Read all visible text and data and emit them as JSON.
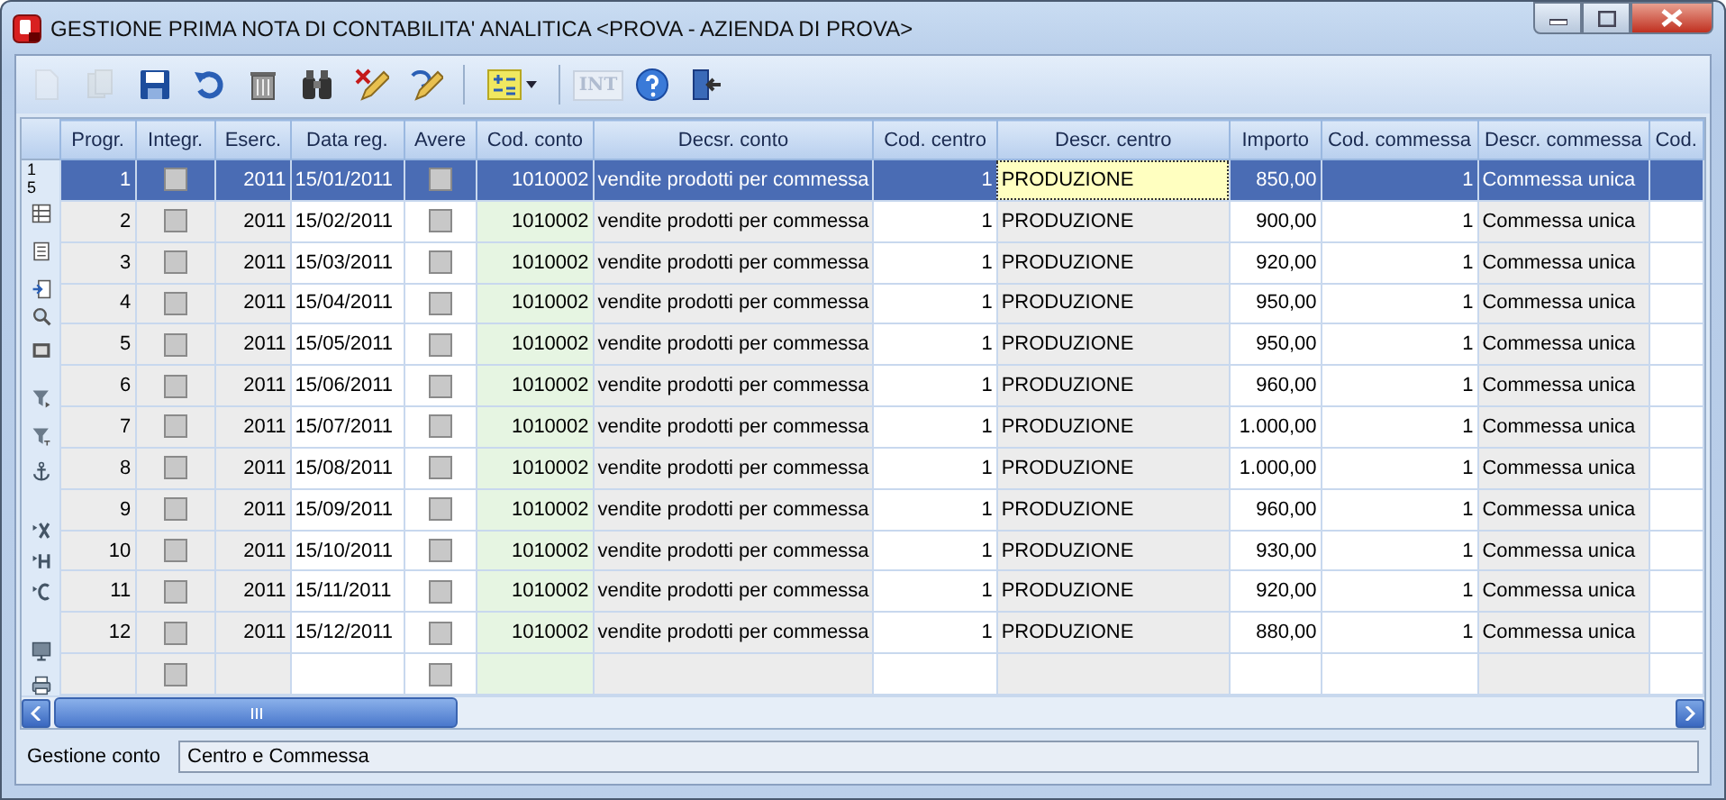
{
  "window": {
    "title": "GESTIONE PRIMA NOTA DI CONTABILITA' ANALITICA <PROVA - AZIENDA DI PROVA>"
  },
  "toolbar": [
    {
      "disabled": true
    },
    {
      "disabled": true
    },
    {
      "disabled": false
    },
    {
      "disabled": false
    },
    {
      "disabled": false
    },
    {
      "disabled": false
    },
    {
      "disabled": false
    },
    {
      "disabled": false
    },
    {
      "disabled": false
    },
    {
      "label": "INT",
      "disabled": true
    },
    {
      "disabled": false
    },
    {
      "disabled": false
    }
  ],
  "record_counter": [
    "1",
    "5"
  ],
  "table": {
    "columns": [
      {
        "label": "Progr.",
        "kind": "readonly-number"
      },
      {
        "label": "Integr.",
        "kind": "readonly-text"
      },
      {
        "label": "Eserc.",
        "kind": "readonly-number"
      },
      {
        "label": "Data reg.",
        "kind": "editable-text"
      },
      {
        "label": "Avere",
        "kind": "editable-text"
      },
      {
        "label": "Cod. conto",
        "kind": "lookup-number"
      },
      {
        "label": "Decsr. conto",
        "kind": "readonly-text"
      },
      {
        "label": "Cod. centro",
        "kind": "editable-number"
      },
      {
        "label": "Descr. centro",
        "kind": "readonly-text"
      },
      {
        "label": "Importo",
        "kind": "editable-number"
      },
      {
        "label": "Cod. commessa",
        "kind": "editable-number"
      },
      {
        "label": "Descr. commessa",
        "kind": "readonly-text"
      },
      {
        "label": "Cod.",
        "kind": "editable-text"
      }
    ],
    "rows": [
      {
        "selected": true,
        "cells": [
          "1",
          {
            "checked": false
          },
          "2011",
          "15/01/2011",
          {
            "checked": false
          },
          "1010002",
          "vendite prodotti per commessa",
          "1",
          {
            "text": "PRODUZIONE",
            "focused": true
          },
          "850,00",
          "1",
          "Commessa unica"
        ]
      },
      {
        "selected": false,
        "cells": [
          "2",
          {
            "checked": false
          },
          "2011",
          "15/02/2011",
          {
            "checked": false
          },
          "1010002",
          "vendite prodotti per commessa",
          "1",
          "PRODUZIONE",
          "900,00",
          "1",
          "Commessa unica"
        ]
      },
      {
        "selected": false,
        "cells": [
          "3",
          {
            "checked": false
          },
          "2011",
          "15/03/2011",
          {
            "checked": false
          },
          "1010002",
          "vendite prodotti per commessa",
          "1",
          "PRODUZIONE",
          "920,00",
          "1",
          "Commessa unica"
        ]
      },
      {
        "selected": false,
        "cells": [
          "4",
          {
            "checked": false
          },
          "2011",
          "15/04/2011",
          {
            "checked": false
          },
          "1010002",
          "vendite prodotti per commessa",
          "1",
          "PRODUZIONE",
          "950,00",
          "1",
          "Commessa unica"
        ]
      },
      {
        "selected": false,
        "cells": [
          "5",
          {
            "checked": false
          },
          "2011",
          "15/05/2011",
          {
            "checked": false
          },
          "1010002",
          "vendite prodotti per commessa",
          "1",
          "PRODUZIONE",
          "950,00",
          "1",
          "Commessa unica"
        ]
      },
      {
        "selected": false,
        "cells": [
          "6",
          {
            "checked": false
          },
          "2011",
          "15/06/2011",
          {
            "checked": false
          },
          "1010002",
          "vendite prodotti per commessa",
          "1",
          "PRODUZIONE",
          "960,00",
          "1",
          "Commessa unica"
        ]
      },
      {
        "selected": false,
        "cells": [
          "7",
          {
            "checked": false
          },
          "2011",
          "15/07/2011",
          {
            "checked": false
          },
          "1010002",
          "vendite prodotti per commessa",
          "1",
          "PRODUZIONE",
          "1.000,00",
          "1",
          "Commessa unica"
        ]
      },
      {
        "selected": false,
        "cells": [
          "8",
          {
            "checked": false
          },
          "2011",
          "15/08/2011",
          {
            "checked": false
          },
          "1010002",
          "vendite prodotti per commessa",
          "1",
          "PRODUZIONE",
          "1.000,00",
          "1",
          "Commessa unica"
        ]
      },
      {
        "selected": false,
        "cells": [
          "9",
          {
            "checked": false
          },
          "2011",
          "15/09/2011",
          {
            "checked": false
          },
          "1010002",
          "vendite prodotti per commessa",
          "1",
          "PRODUZIONE",
          "960,00",
          "1",
          "Commessa unica"
        ]
      },
      {
        "selected": false,
        "cells": [
          "10",
          {
            "checked": false
          },
          "2011",
          "15/10/2011",
          {
            "checked": false
          },
          "1010002",
          "vendite prodotti per commessa",
          "1",
          "PRODUZIONE",
          "930,00",
          "1",
          "Commessa unica"
        ]
      },
      {
        "selected": false,
        "cells": [
          "11",
          {
            "checked": false
          },
          "2011",
          "15/11/2011",
          {
            "checked": false
          },
          "1010002",
          "vendite prodotti per commessa",
          "1",
          "PRODUZIONE",
          "920,00",
          "1",
          "Commessa unica"
        ]
      },
      {
        "selected": false,
        "cells": [
          "12",
          {
            "checked": false
          },
          "2011",
          "15/12/2011",
          {
            "checked": false
          },
          "1010002",
          "vendite prodotti per commessa",
          "1",
          "PRODUZIONE",
          "880,00",
          "1",
          "Commessa unica"
        ]
      },
      {
        "selected": false,
        "cells": [
          null,
          {
            "checked": false
          },
          null,
          null,
          {
            "checked": false
          },
          null,
          null,
          null,
          null,
          null,
          null,
          null
        ]
      }
    ]
  },
  "footer": {
    "label": "Gestione conto",
    "value": "Centro e Commessa"
  }
}
